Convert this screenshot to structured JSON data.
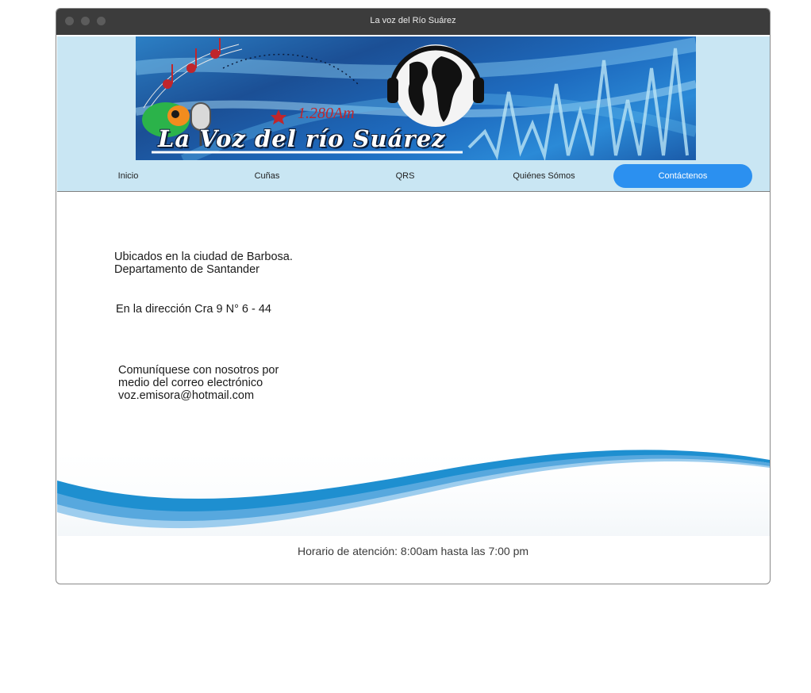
{
  "window": {
    "title": "La voz del Río Suárez"
  },
  "banner": {
    "frequency": "1.280Am",
    "name": "La Voz del río Suárez"
  },
  "nav": {
    "items": [
      {
        "label": "Inicio"
      },
      {
        "label": "Cuñas"
      },
      {
        "label": "QRS"
      },
      {
        "label": "Quiénes Sómos"
      },
      {
        "label": "Contáctenos",
        "active": true
      }
    ]
  },
  "content": {
    "location_line1": "Ubicados en la ciudad de Barbosa.",
    "location_line2": "Departamento de Santander",
    "address": "En la dirección Cra 9 N° 6 - 44",
    "contact_line1": "Comuníquese con nosotros por",
    "contact_line2": "medio del correo electrónico",
    "email": "voz.emisora@hotmail.com"
  },
  "footer": {
    "hours": "Horario de atención: 8:00am hasta las 7:00 pm"
  },
  "colors": {
    "titlebar": "#3c3c3c",
    "header_bg": "#c9e6f3",
    "active_tab": "#2b90f0",
    "wave": "#1e8fd0"
  }
}
